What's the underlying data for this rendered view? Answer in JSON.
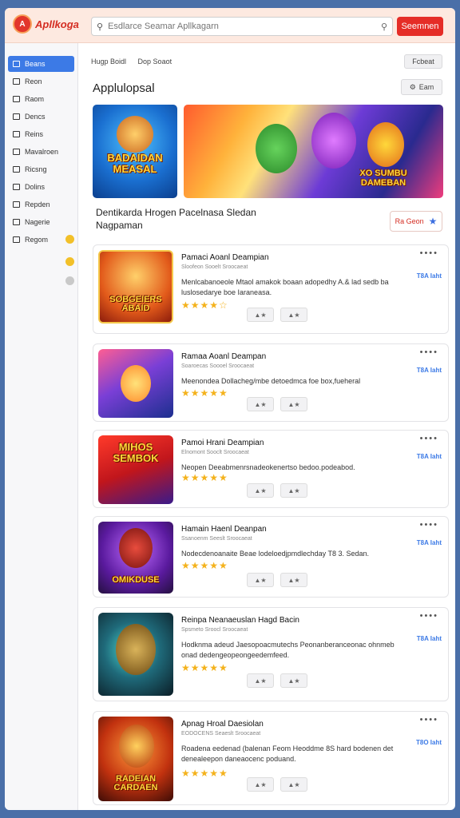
{
  "app": {
    "logo_text": "Apllkoga",
    "search_placeholder": "Esdlarce Seamar Apllkagarn",
    "search_button": "Seemnen"
  },
  "sidebar": {
    "items": [
      {
        "label": "Beans",
        "active": true
      },
      {
        "label": "Reon"
      },
      {
        "label": "Raom"
      },
      {
        "label": "Dencs"
      },
      {
        "label": "Reins"
      },
      {
        "label": "Mavalroen"
      },
      {
        "label": "Ricsng"
      },
      {
        "label": "Dolins"
      },
      {
        "label": "Repden"
      },
      {
        "label": "Nagerie"
      },
      {
        "label": "Regom"
      }
    ],
    "status_colors": [
      "#f2c029",
      "#f2c029",
      "#c9c9c9"
    ]
  },
  "main": {
    "crumbs": [
      "Hugp Boidl",
      "Dop Soaot"
    ],
    "filter_button": "Fcbeat",
    "page_title": "Applulopsal",
    "page_button": "Eam",
    "featured": {
      "tile_a_text": "BADAIDAN MEASAL",
      "tile_b_text": "XO SUMBU DAMEBAN"
    },
    "section_title": "Dentikarda Hrogen Pacelnasa Sledan Nagpaman",
    "view_button": "Ra Geon"
  },
  "cards": [
    {
      "title": "Pamaci Aoanl Deampian",
      "sub": "Sloofeon Sooelt Sroocaeat",
      "desc": "Menlcabanoeole Mtaol amakok boaan adopedhy A.& lad sedb ba luslosedarye boe Iaraneasa.",
      "rating": 4.5,
      "price": "T8A Iaht",
      "thumb_text": "SOBGEIERS ABAID"
    },
    {
      "title": "Ramaa Aoanl Deampan",
      "sub": "Soaroecas Soooel Sroocaeat",
      "desc": "Meenondea Dollacheg/mbe detoedmca foe box,fueheral",
      "rating": 5,
      "price": "T8A Iaht",
      "thumb_text": ""
    },
    {
      "title": "Pamoi Hrani Deampian",
      "sub": "Elnomont Sooclt Sroocaeat",
      "desc": "Neopen Deeabmenrsnadeokenertso bedoo.podeabod.",
      "rating": 5,
      "price": "T8A Iaht",
      "thumb_text": "MIHOS SEMBOK"
    },
    {
      "title": "Hamain Haenl Deanpan",
      "sub": "Ssanoenm Seeslt Sroocaeat",
      "desc": "Nodecdenoanaite Beae lodeloedjpmdlechday T8 3. Sedan.",
      "rating": 5,
      "price": "T8A Iaht",
      "thumb_text": "OMIKDUSE"
    },
    {
      "title": "Reinpa Neanaeuslan Hagd Bacin",
      "sub": "Spsmeto Sroocl Sroocaeat",
      "desc": "Hodknma adeud Jaesopoacmutechs Peonanberanceonac ohnmeb onad dedengeopeongeedemfeed.",
      "rating": 5,
      "price": "T8A Iaht",
      "thumb_text": ""
    },
    {
      "title": "Apnag Hroal Daesiolan",
      "sub": "EODOCENS Seaeslt Sroocaeat",
      "desc": "Roadena eedenad (balenan Feom Heoddme 8S hard bodenen det denealeepon daneaocenc poduand.",
      "rating": 5,
      "price": "T8O Iaht",
      "thumb_text": "RADEIAN CARDAEN"
    }
  ]
}
